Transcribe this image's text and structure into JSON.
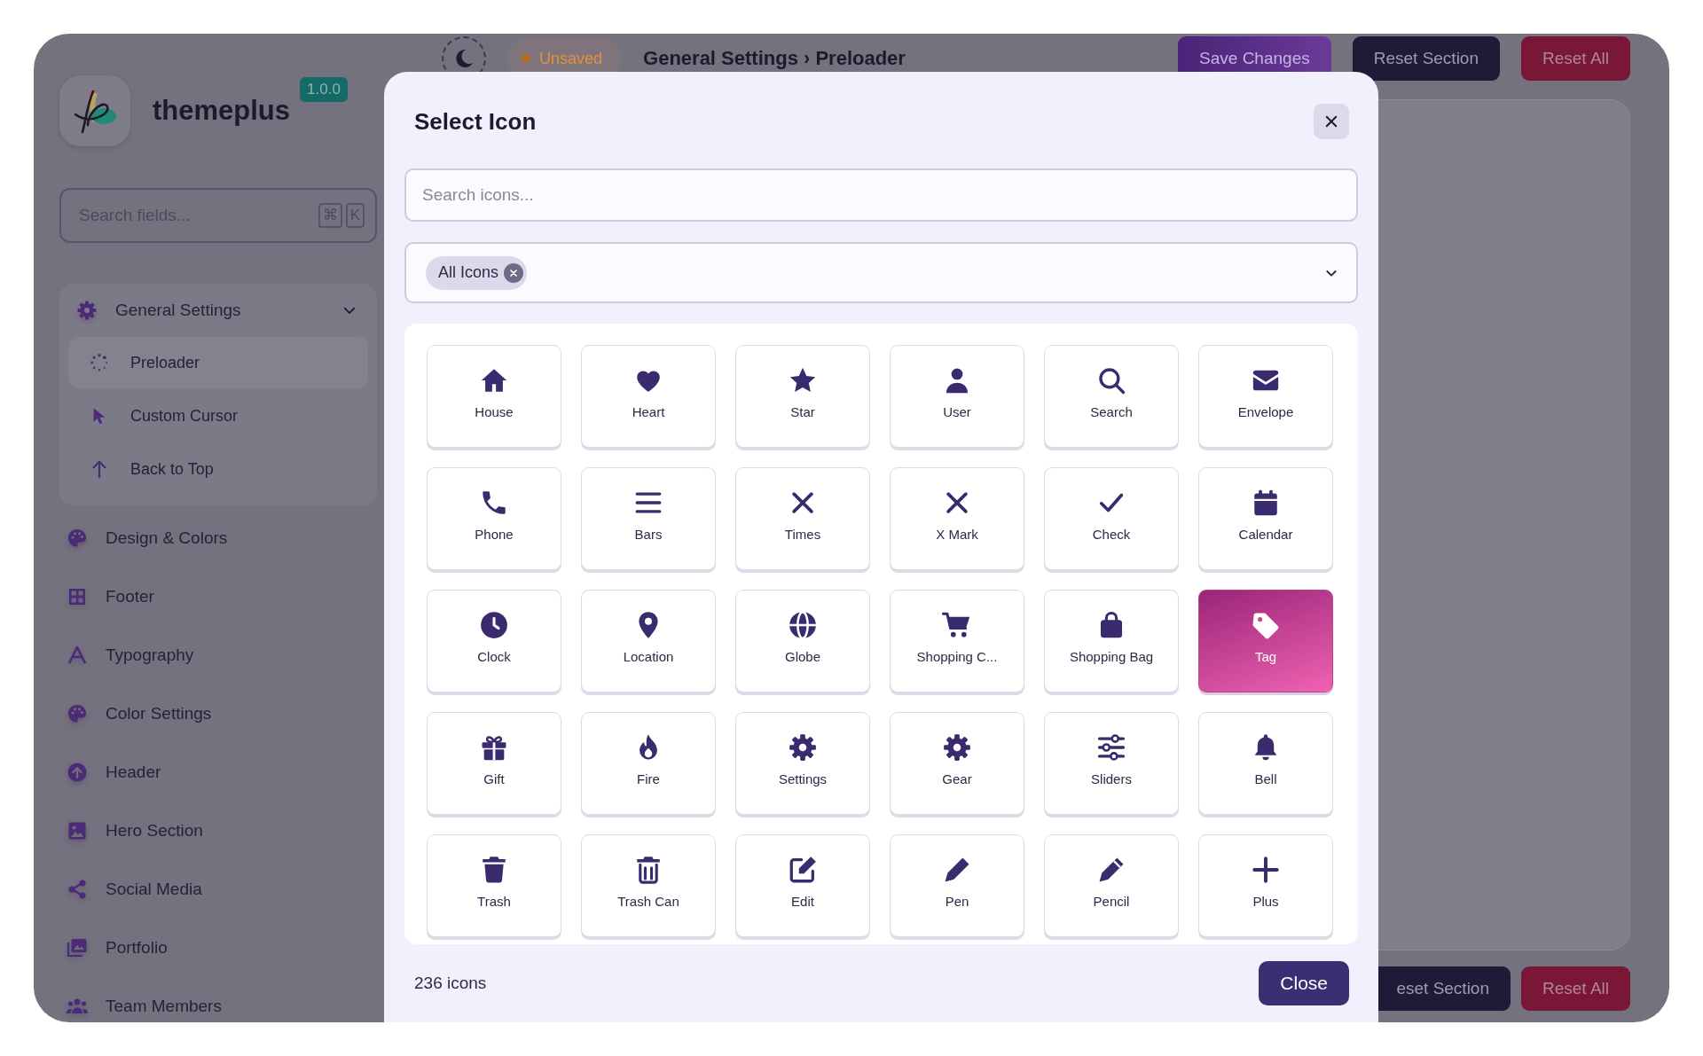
{
  "sidebar": {
    "brand": "themeplus",
    "version": "1.0.0",
    "search": {
      "placeholder": "Search fields...",
      "shortcut": [
        "⌘",
        "K"
      ]
    },
    "groups": [
      {
        "label": "General Settings",
        "expanded": true,
        "children": [
          {
            "label": "Preloader",
            "selected": true
          },
          {
            "label": "Custom Cursor",
            "selected": false
          },
          {
            "label": "Back to Top",
            "selected": false
          }
        ]
      }
    ],
    "items": [
      {
        "label": "Design & Colors",
        "selected": false
      },
      {
        "label": "Footer",
        "selected": false
      },
      {
        "label": "Typography",
        "selected": false
      },
      {
        "label": "Color Settings",
        "selected": false
      },
      {
        "label": "Header",
        "selected": false
      },
      {
        "label": "Hero Section",
        "selected": false
      },
      {
        "label": "Social Media",
        "selected": false
      },
      {
        "label": "Portfolio",
        "selected": false
      },
      {
        "label": "Team Members",
        "selected": false
      }
    ]
  },
  "topbar": {
    "status": "Unsaved",
    "breadcrumb": "General Settings › Preloader",
    "buttons": [
      {
        "label": "Save Changes",
        "kind": "primary"
      },
      {
        "label": "Reset Section",
        "kind": "dark"
      },
      {
        "label": "Reset All",
        "kind": "danger"
      }
    ]
  },
  "bottombar": {
    "buttons": [
      {
        "label": "eset Section",
        "kind": "dark"
      },
      {
        "label": "Reset All",
        "kind": "danger"
      }
    ]
  },
  "modal": {
    "title": "Select Icon",
    "search": {
      "placeholder": "Search icons..."
    },
    "filter": {
      "chips": [
        {
          "label": "All Icons"
        }
      ]
    },
    "icons": [
      {
        "label": "House",
        "selected": false
      },
      {
        "label": "Heart",
        "selected": false
      },
      {
        "label": "Star",
        "selected": false
      },
      {
        "label": "User",
        "selected": false
      },
      {
        "label": "Search",
        "selected": false
      },
      {
        "label": "Envelope",
        "selected": false
      },
      {
        "label": "Phone",
        "selected": false
      },
      {
        "label": "Bars",
        "selected": false
      },
      {
        "label": "Times",
        "selected": false
      },
      {
        "label": "X Mark",
        "selected": false
      },
      {
        "label": "Check",
        "selected": false
      },
      {
        "label": "Calendar",
        "selected": false
      },
      {
        "label": "Clock",
        "selected": false
      },
      {
        "label": "Location",
        "selected": false
      },
      {
        "label": "Globe",
        "selected": false
      },
      {
        "label": "Shopping C...",
        "selected": false
      },
      {
        "label": "Shopping Bag",
        "selected": false
      },
      {
        "label": "Tag",
        "selected": true
      },
      {
        "label": "Gift",
        "selected": false
      },
      {
        "label": "Fire",
        "selected": false
      },
      {
        "label": "Settings",
        "selected": false
      },
      {
        "label": "Gear",
        "selected": false
      },
      {
        "label": "Sliders",
        "selected": false
      },
      {
        "label": "Bell",
        "selected": false
      },
      {
        "label": "Trash",
        "selected": false
      },
      {
        "label": "Trash Can",
        "selected": false
      },
      {
        "label": "Edit",
        "selected": false
      },
      {
        "label": "Pen",
        "selected": false
      },
      {
        "label": "Pencil",
        "selected": false
      },
      {
        "label": "Plus",
        "selected": false
      }
    ],
    "count": "236 icons",
    "close_button": "Close"
  }
}
